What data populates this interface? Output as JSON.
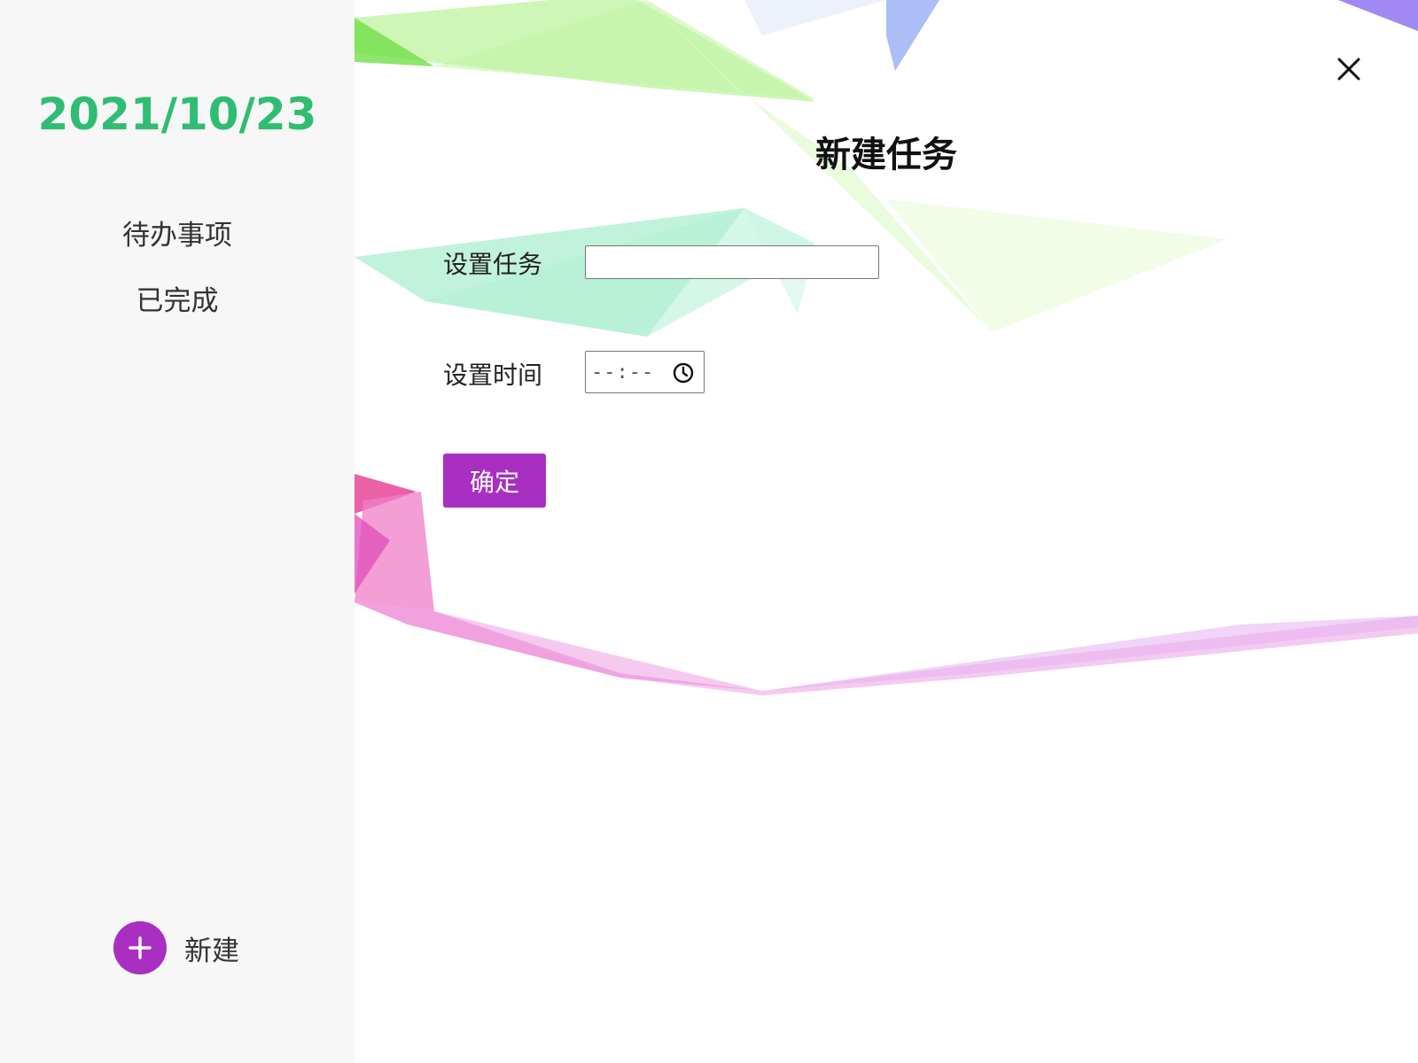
{
  "sidebar": {
    "date": "2021/10/23",
    "nav": {
      "todo_label": "待办事项",
      "done_label": "已完成"
    },
    "new_button": {
      "icon": "plus-icon",
      "label": "新建"
    }
  },
  "dialog": {
    "close_icon": "close-icon",
    "title": "新建任务",
    "task": {
      "label": "设置任务",
      "value": "",
      "placeholder": ""
    },
    "time": {
      "label": "设置时间",
      "value": "--:--",
      "icon": "clock-icon"
    },
    "confirm_label": "确定"
  },
  "colors": {
    "accent_green": "#2ebd72",
    "accent_purple": "#a82fc2",
    "sidebar_bg": "#f7f7f7"
  }
}
